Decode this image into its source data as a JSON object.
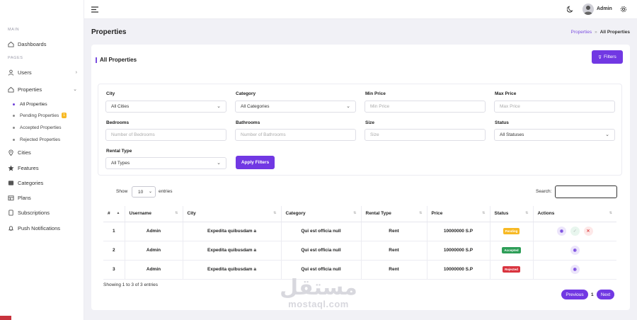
{
  "topbar": {
    "admin_name": "Admin"
  },
  "sidebar": {
    "main_label": "MAIN",
    "pages_label": "PAGES",
    "items": [
      {
        "label": "Dashboards"
      },
      {
        "label": "Users"
      },
      {
        "label": "Properties"
      },
      {
        "label": "Cities"
      },
      {
        "label": "Features"
      },
      {
        "label": "Categories"
      },
      {
        "label": "Plans"
      },
      {
        "label": "Subscriptions"
      },
      {
        "label": "Push Notifications"
      }
    ],
    "sub_items": [
      {
        "label": "All Properties"
      },
      {
        "label": "Pending Properties",
        "badge": "1"
      },
      {
        "label": "Accepted Properties"
      },
      {
        "label": "Rejected Properties"
      }
    ]
  },
  "page": {
    "title": "Properties",
    "breadcrumb": {
      "parent": "Properties",
      "separator": "»",
      "current": "All Properties"
    }
  },
  "card": {
    "title": "All Properties",
    "filters_button": "Filters",
    "apply_button": "Apply Filters"
  },
  "filters": {
    "city": {
      "label": "City",
      "value": "All Cities"
    },
    "category": {
      "label": "Category",
      "value": "All Categories"
    },
    "min_price": {
      "label": "Min Price",
      "placeholder": "Min Price"
    },
    "max_price": {
      "label": "Max Price",
      "placeholder": "Max Price"
    },
    "bedrooms": {
      "label": "Bedrooms",
      "placeholder": "Number of Bedrooms"
    },
    "bathrooms": {
      "label": "Bathrooms",
      "placeholder": "Number of Bathrooms"
    },
    "size": {
      "label": "Size",
      "placeholder": "Size"
    },
    "status": {
      "label": "Status",
      "value": "All Statuses"
    },
    "rental_type": {
      "label": "Rental Type",
      "value": "All Types"
    }
  },
  "table_controls": {
    "show_label": "Show",
    "page_size": "10",
    "entries_label": "entries",
    "search_label": "Search:"
  },
  "table": {
    "columns": [
      "#",
      "Username",
      "City",
      "Category",
      "Rental Type",
      "Price",
      "Status",
      "Actions"
    ],
    "rows": [
      {
        "num": "1",
        "username": "Admin",
        "city": "Expedita quibusdam a",
        "category": "Qui est officia null",
        "rental_type": "Rent",
        "price": "10000000 S.P",
        "status": "Pending",
        "status_color": "#f7b924"
      },
      {
        "num": "2",
        "username": "Admin",
        "city": "Expedita quibusdam a",
        "category": "Qui est officia null",
        "rental_type": "Rent",
        "price": "10000000 S.P",
        "status": "Accepted",
        "status_color": "#2e9e58"
      },
      {
        "num": "3",
        "username": "Admin",
        "city": "Expedita quibusdam a",
        "category": "Qui est officia null",
        "rental_type": "Rent",
        "price": "10000000 S.P",
        "status": "Rejected",
        "status_color": "#d9343f"
      }
    ]
  },
  "footer": {
    "info": "Showing 1 to 3 of 3 entries",
    "prev": "Previous",
    "page": "1",
    "next": "Next"
  },
  "watermark": {
    "logo": "مستقل",
    "text": "mostaql.com"
  },
  "colors": {
    "accent": "#7138e3",
    "pending": "#f7b924",
    "accepted": "#2e9e58",
    "rejected": "#d9343f"
  }
}
